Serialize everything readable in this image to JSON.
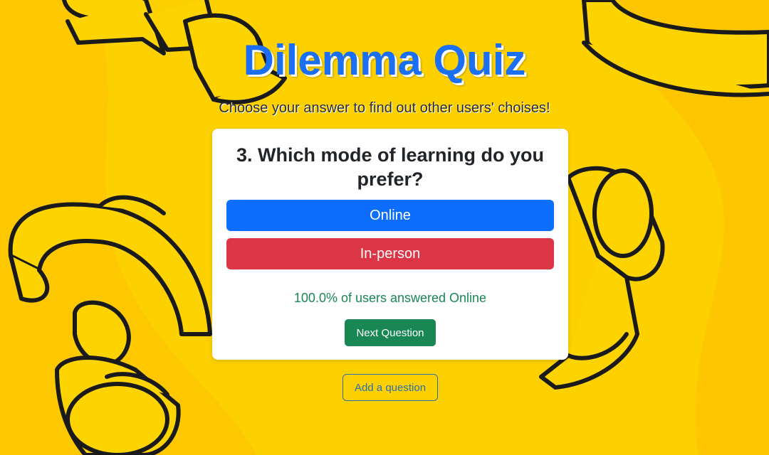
{
  "header": {
    "title": "Dilemma Quiz",
    "subtitle": "Choose your answer to find out other users' choises!"
  },
  "quiz": {
    "question": "3. Which mode of learning do you prefer?",
    "answers": [
      {
        "label": "Online",
        "color": "#0d6efd"
      },
      {
        "label": "In-person",
        "color": "#dc3545"
      }
    ],
    "result": "100.0% of users answered Online",
    "next_label": "Next Question"
  },
  "footer": {
    "add_label": "Add a question"
  },
  "theme": {
    "background": "#fdd000",
    "title_color": "#1a6ff2",
    "success": "#198754",
    "decoration_icon": "question-mark-icon"
  }
}
